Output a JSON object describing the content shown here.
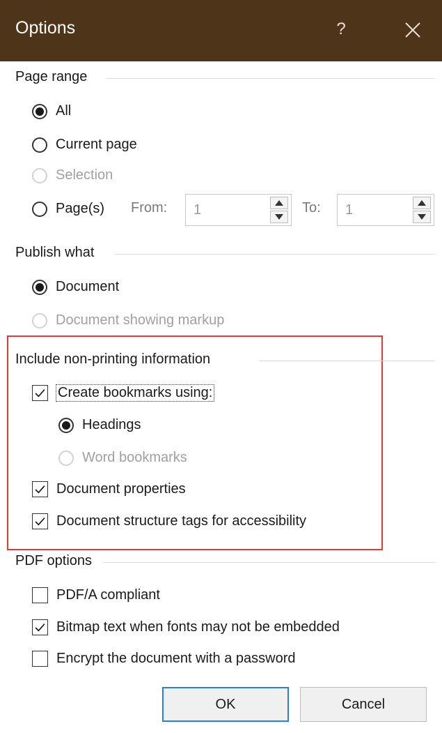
{
  "title": "Options",
  "title_buttons": {
    "help": "?"
  },
  "page_range": {
    "label": "Page range",
    "all": "All",
    "current_page": "Current page",
    "selection": "Selection",
    "pages": "Page(s)",
    "from_label": "From:",
    "from_value": "1",
    "to_label": "To:",
    "to_value": "1",
    "selected": "all"
  },
  "publish_what": {
    "label": "Publish what",
    "document": "Document",
    "document_markup": "Document showing markup",
    "selected": "document"
  },
  "non_printing": {
    "label": "Include non-printing information",
    "create_bookmarks": "Create bookmarks using:",
    "create_bookmarks_checked": true,
    "headings": "Headings",
    "word_bookmarks": "Word bookmarks",
    "bookmark_source": "headings",
    "doc_properties": "Document properties",
    "doc_properties_checked": true,
    "structure_tags": "Document structure tags for accessibility",
    "structure_tags_checked": true
  },
  "pdf_options": {
    "label": "PDF options",
    "pdfa": "PDF/A compliant",
    "pdfa_checked": false,
    "bitmap_text": "Bitmap text when fonts may not be embedded",
    "bitmap_text_checked": true,
    "encrypt": "Encrypt the document with a password",
    "encrypt_checked": false
  },
  "buttons": {
    "ok": "OK",
    "cancel": "Cancel"
  },
  "colors": {
    "titlebar": "#4e3519",
    "highlight": "#e23a3a",
    "ok_border": "#2f7fd0"
  }
}
